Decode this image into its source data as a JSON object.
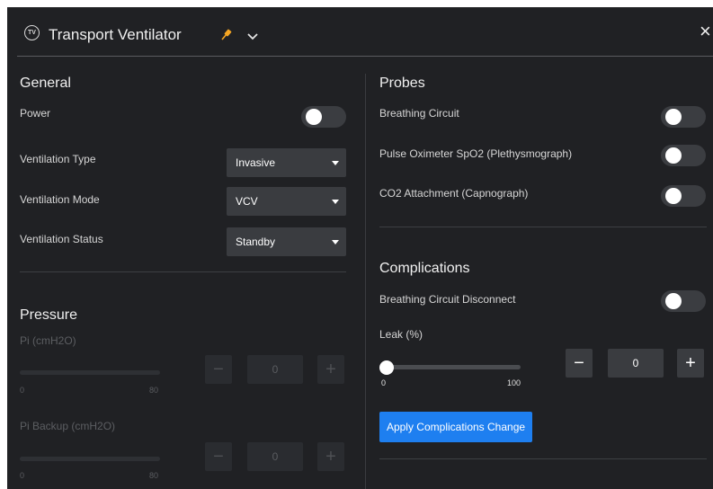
{
  "window": {
    "title": "Transport Ventilator",
    "badge": "TV",
    "close_label": "×"
  },
  "general": {
    "heading": "General",
    "power_label": "Power",
    "ventilation_type": {
      "label": "Ventilation Type",
      "value": "Invasive"
    },
    "ventilation_mode": {
      "label": "Ventilation Mode",
      "value": "VCV"
    },
    "ventilation_status": {
      "label": "Ventilation Status",
      "value": "Standby"
    }
  },
  "pressure": {
    "heading": "Pressure",
    "pi": {
      "label": "Pi (cmH2O)",
      "min": "0",
      "max": "80",
      "value": "0"
    },
    "pi_backup": {
      "label": "Pi Backup (cmH2O)",
      "min": "0",
      "max": "80",
      "value": "0"
    }
  },
  "probes": {
    "heading": "Probes",
    "items": [
      {
        "label": "Breathing Circuit"
      },
      {
        "label": "Pulse Oximeter SpO2 (Plethysmograph)"
      },
      {
        "label": "CO2 Attachment (Capnograph)"
      }
    ]
  },
  "complications": {
    "heading": "Complications",
    "disconnect_label": "Breathing Circuit Disconnect",
    "leak": {
      "label": "Leak (%)",
      "min": "0",
      "max": "100",
      "value": "0"
    },
    "apply_label": "Apply Complications Change"
  },
  "colors": {
    "background": "#202124",
    "accent": "#1e7ff0",
    "pin": "#f5a623"
  }
}
